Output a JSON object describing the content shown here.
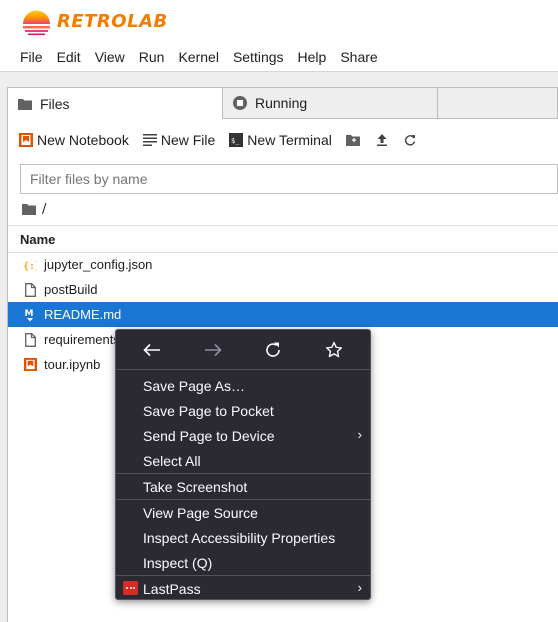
{
  "app": {
    "logo_text": "RETROLAB",
    "logo_colors": {
      "top": "#ffb300",
      "mid": "#f57c00",
      "bottom": "#e91e63"
    }
  },
  "menubar": {
    "items": [
      "File",
      "Edit",
      "View",
      "Run",
      "Kernel",
      "Settings",
      "Help",
      "Share"
    ]
  },
  "tabs": [
    {
      "label": "Files",
      "icon": "folder-icon",
      "active": true
    },
    {
      "label": "Running",
      "icon": "stop-circle-icon",
      "active": false
    }
  ],
  "toolbar": {
    "new_notebook": "New Notebook",
    "new_file": "New File",
    "new_terminal": "New Terminal",
    "icons": [
      "new-folder-icon",
      "upload-icon",
      "refresh-icon"
    ]
  },
  "filter": {
    "placeholder": "Filter files by name"
  },
  "breadcrumb": {
    "path": "/"
  },
  "listing": {
    "header": "Name",
    "files": [
      {
        "name": "jupyter_config.json",
        "icon": "json-icon",
        "selected": false
      },
      {
        "name": "postBuild",
        "icon": "file-icon",
        "selected": false
      },
      {
        "name": "README.md",
        "icon": "markdown-icon",
        "selected": true
      },
      {
        "name": "requirements",
        "icon": "file-icon",
        "selected": false
      },
      {
        "name": "tour.ipynb",
        "icon": "notebook-icon",
        "selected": false
      }
    ]
  },
  "context_menu": {
    "nav": [
      "back-icon",
      "forward-icon",
      "reload-icon",
      "bookmark-star-icon"
    ],
    "items": [
      {
        "label": "Save Page As…",
        "submenu": false
      },
      {
        "label": "Save Page to Pocket",
        "submenu": false
      },
      {
        "label": "Send Page to Device",
        "submenu": true
      },
      {
        "label": "Select All",
        "submenu": false
      },
      {
        "label": "Take Screenshot",
        "submenu": false
      },
      {
        "label": "View Page Source",
        "submenu": false
      },
      {
        "label": "Inspect Accessibility Properties",
        "submenu": false
      },
      {
        "label": "Inspect (Q)",
        "submenu": false
      },
      {
        "label": "LastPass",
        "submenu": true
      }
    ],
    "colors": {
      "background": "#2b2a33",
      "text": "#fbfbfe",
      "lastpass": "#d32d27"
    }
  },
  "colors": {
    "selection": "#1976d2",
    "accent": "#f57c00",
    "notebook": "#e65100"
  }
}
